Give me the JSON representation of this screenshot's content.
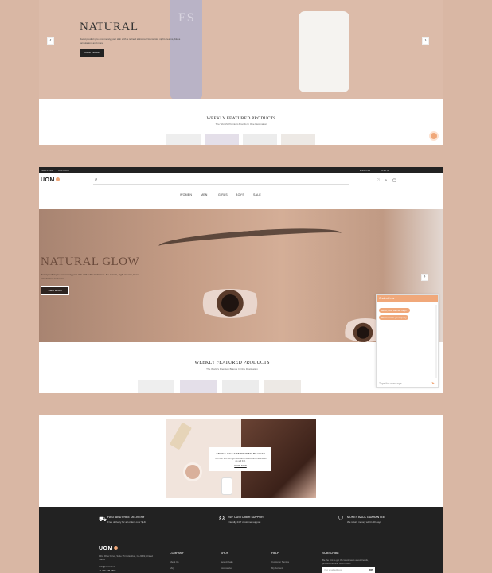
{
  "panel1": {
    "hero_title": "NATURAL",
    "hero_text": "Boost product pro and merely your skin with a refined skincare. No cosmic, night creams, blues formulation, and more.",
    "hero_button": "VIEW MORE",
    "bottle_logo": "ES",
    "featured_title": "WEEKLY FEATURED PRODUCTS",
    "featured_subtitle": "The World's Premium Brands In One Destination"
  },
  "panel2": {
    "topbar_left": [
      "SHIPPING",
      "CONTACT"
    ],
    "topbar_right": [
      "ENGLISH",
      "USD $"
    ],
    "logo_text": "UOM",
    "menu": [
      "WOMEN",
      "MEN",
      "GIRLS",
      "BOYS",
      "SALE"
    ],
    "hero_title": "NATURAL GLOW",
    "hero_text": "Boost product pro and merely your skin with refined skincare. No cosmic, night creams, blues formulation, and more.",
    "hero_button": "VIEW MORE",
    "featured_title": "WEEKLY FEATURED PRODUCTS",
    "featured_subtitle": "The World's Premium Brands In One Destination"
  },
  "chat": {
    "header": "Chat with us",
    "messages": [
      "Hello, how can we help?",
      "Please write your query"
    ],
    "input_placeholder": "Type the message ..."
  },
  "panel3": {
    "promo_title": "ABOUT OUT THE HIDDEN BEAUTY",
    "promo_text": "Your skin with the right skincare products and treatments we will find.",
    "promo_link": "SHOP NOW"
  },
  "footer": {
    "features": [
      {
        "title": "FAST AND FREE DELIVERY",
        "text": "Free delivery for all orders over $140"
      },
      {
        "title": "24/7 CUSTOMER SUPPORT",
        "text": "Friendly 24/7 customer support"
      },
      {
        "title": "MONEY BACK GUARANTEE",
        "text": "We return money within 30 days"
      }
    ],
    "logo_text": "UOM",
    "address": "1418 River Drive, Suite 35 Cottonhall, CA 9622, United States",
    "email": "sale@uomo.com",
    "phone": "+1 246-345-0695",
    "columns": [
      {
        "title": "COMPANY",
        "items": [
          "About Us",
          "FAQ"
        ]
      },
      {
        "title": "SHOP",
        "items": [
          "New Arrivals",
          "Accessories"
        ]
      },
      {
        "title": "HELP",
        "items": [
          "Customer Service",
          "My Account"
        ]
      }
    ],
    "subscribe_title": "SUBSCRIBE",
    "subscribe_text": "Be the first to get the latest news about trends, promotions, and much more!",
    "subscribe_placeholder": "Your email address",
    "subscribe_button": "JOIN"
  },
  "colors": {
    "accent": "#f0a87a",
    "dark": "#222222",
    "page_bg": "#d9b7a4"
  }
}
